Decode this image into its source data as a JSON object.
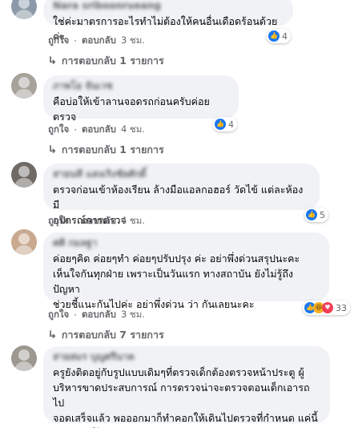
{
  "labels": {
    "like": "ถูกใจ",
    "reply": "ตอบกลับ",
    "separator": "·"
  },
  "comments": [
    {
      "author": "Nara sriboonrueang",
      "text": "ใช่ค่ะมาตรการอะไรทำไม่ต้องให้คนอื่นเดือดร้อนด้วยค่ะ",
      "time": "3 ชม.",
      "reactions": [
        "like"
      ],
      "reaction_count": "4",
      "replies_label": "การตอบกลับ 1 รายการ"
    },
    {
      "author": "ภาพโอ จันเวช",
      "text": "คือบ่อให้เข้าลานจอดรถก่อนครับค่อยตรวจ",
      "time": "4 ชม.",
      "reactions": [
        "like"
      ],
      "reaction_count": "4",
      "replies_label": "การตอบกลับ 1 รายการ"
    },
    {
      "author": "สายนที แสงเริงชัยศักดิ์",
      "text": "ตรวจก่อนเข้าห้องเรียน ล้างมือแอลกอฮอร์ วัดไข้ แต่ละห้อง มี\nอุปกรณ์การตรวจ",
      "time": "4 ชม.",
      "reactions": [
        "like"
      ],
      "reaction_count": "5",
      "replies_label": ""
    },
    {
      "author": "ศศิ กมลฐา",
      "text": "ค่อยๆคิด ค่อยๆทำ ค่อยๆปรับปรุง ค่ะ อย่าพึ่งด่วนสรุปนะคะ\nเห็นใจกันทุกฝ่าย เพราะเป็นวันแรก ทางสถาบัน ยังไม่รู้ถึงปัญหา\nช่วยชี้แนะกันไปค่ะ อย่าพึ่งด่วน ว่า กันเลยนะคะ",
      "time": "3 ชม.",
      "reactions": [
        "like",
        "haha",
        "love"
      ],
      "reaction_count": "33",
      "replies_label": "การตอบกลับ 7 รายการ"
    },
    {
      "author": "สายสมร บุญศรีนาค",
      "text": "ครูยังติดอยู่กับรูปแบบเดิมๆที่ตรวจเด็กต้องตรวจหน้าประตู ผู้\nบริหารขาดประสบการณ์ การตรวจน่าจะตรวจตอนเด็กเอารถไป\nจอดเสร็จแล้ว พอออกมาก็ทำคอกให้เดินไปตรวจที่กำหนด แค่นี้\nชาวบ้านก็ไม่เดือดร้อนแล้ว ผู้บริหารต้องคิดนอกกรอบ",
      "time": "",
      "reactions": [],
      "reaction_count": "",
      "replies_label": ""
    }
  ],
  "avatar_colors": [
    "#8a9aa8",
    "#a7a39b",
    "#6f6a66",
    "#c9a98f",
    "#9c9890"
  ],
  "accent_color": "#1877f2"
}
